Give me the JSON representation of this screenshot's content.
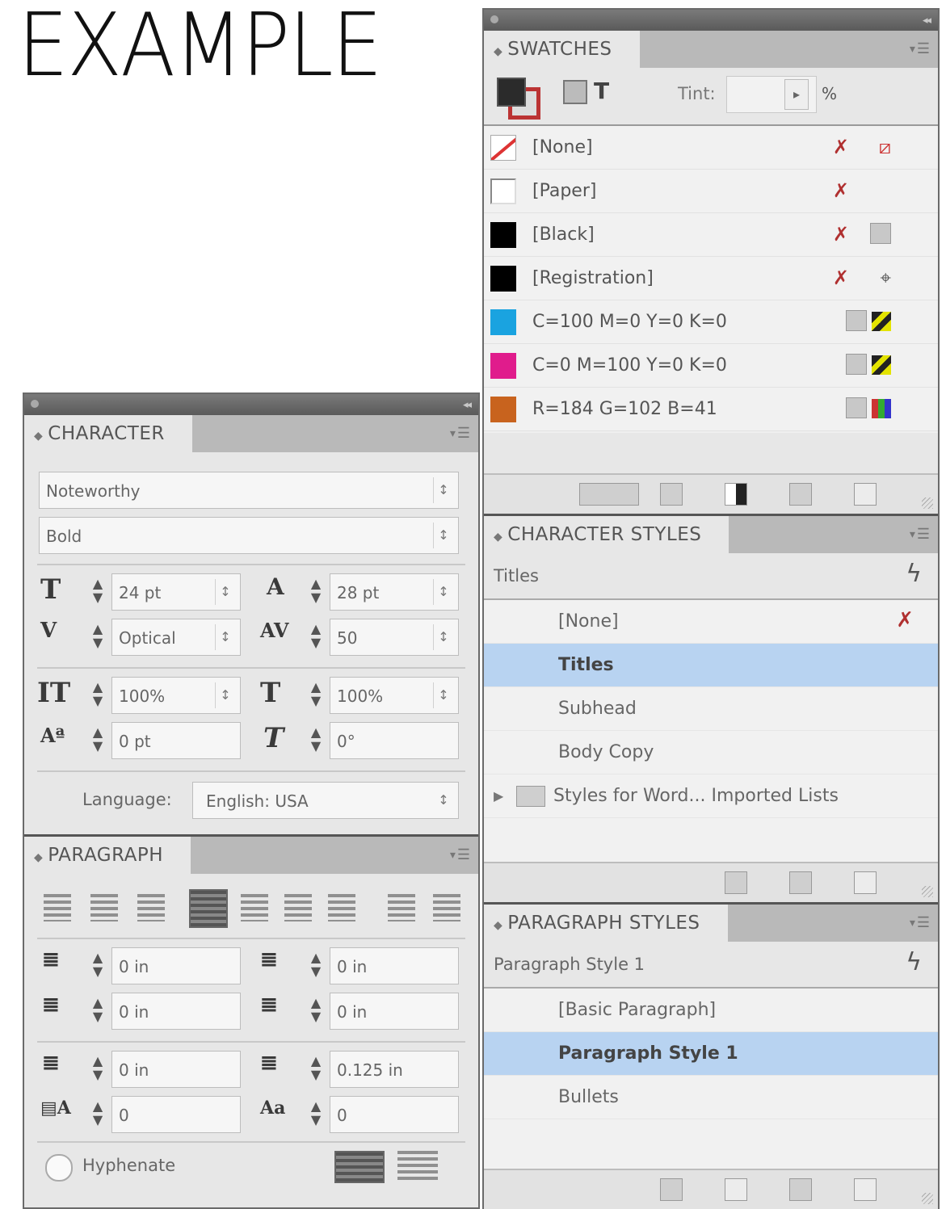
{
  "heading": "EXAMPLE",
  "swatches": {
    "tab": "SWATCHES",
    "tint_label": "Tint:",
    "tint_unit": "%",
    "items": [
      {
        "name": "[None]",
        "chip": "none"
      },
      {
        "name": "[Paper]",
        "chip": "paper"
      },
      {
        "name": "[Black]",
        "chip": "#000000"
      },
      {
        "name": "[Registration]",
        "chip": "#000000"
      },
      {
        "name": "C=100 M=0 Y=0 K=0",
        "chip": "#1aa3e0"
      },
      {
        "name": "C=0 M=100 Y=0 K=0",
        "chip": "#e01c8c"
      },
      {
        "name": "R=184 G=102 B=41",
        "chip": "#c8631e"
      }
    ]
  },
  "character_styles": {
    "tab": "CHARACTER STYLES",
    "current": "Titles",
    "items": [
      {
        "name": "[None]"
      },
      {
        "name": "Titles"
      },
      {
        "name": "Subhead"
      },
      {
        "name": "Body Copy"
      },
      {
        "name": "Styles for Word... Imported Lists"
      }
    ]
  },
  "paragraph_styles": {
    "tab": "PARAGRAPH STYLES",
    "current": "Paragraph Style 1",
    "items": [
      {
        "name": "[Basic Paragraph]"
      },
      {
        "name": "Paragraph Style 1"
      },
      {
        "name": "Bullets"
      }
    ]
  },
  "character": {
    "tab": "CHARACTER",
    "font_family": "Noteworthy",
    "font_style": "Bold",
    "font_size": "24 pt",
    "leading": "28 pt",
    "kerning": "Optical",
    "tracking": "50",
    "vertical_scale": "100%",
    "horizontal_scale": "100%",
    "baseline_shift": "0 pt",
    "skew": "0°",
    "language_label": "Language:",
    "language": "English: USA"
  },
  "paragraph": {
    "tab": "PARAGRAPH",
    "left_indent": "0 in",
    "right_indent": "0 in",
    "first_line_indent": "0 in",
    "last_line_indent": "0 in",
    "space_before": "0 in",
    "space_after": "0.125 in",
    "drop_cap_lines": "0",
    "drop_cap_chars": "0",
    "hyphenate_label": "Hyphenate"
  }
}
